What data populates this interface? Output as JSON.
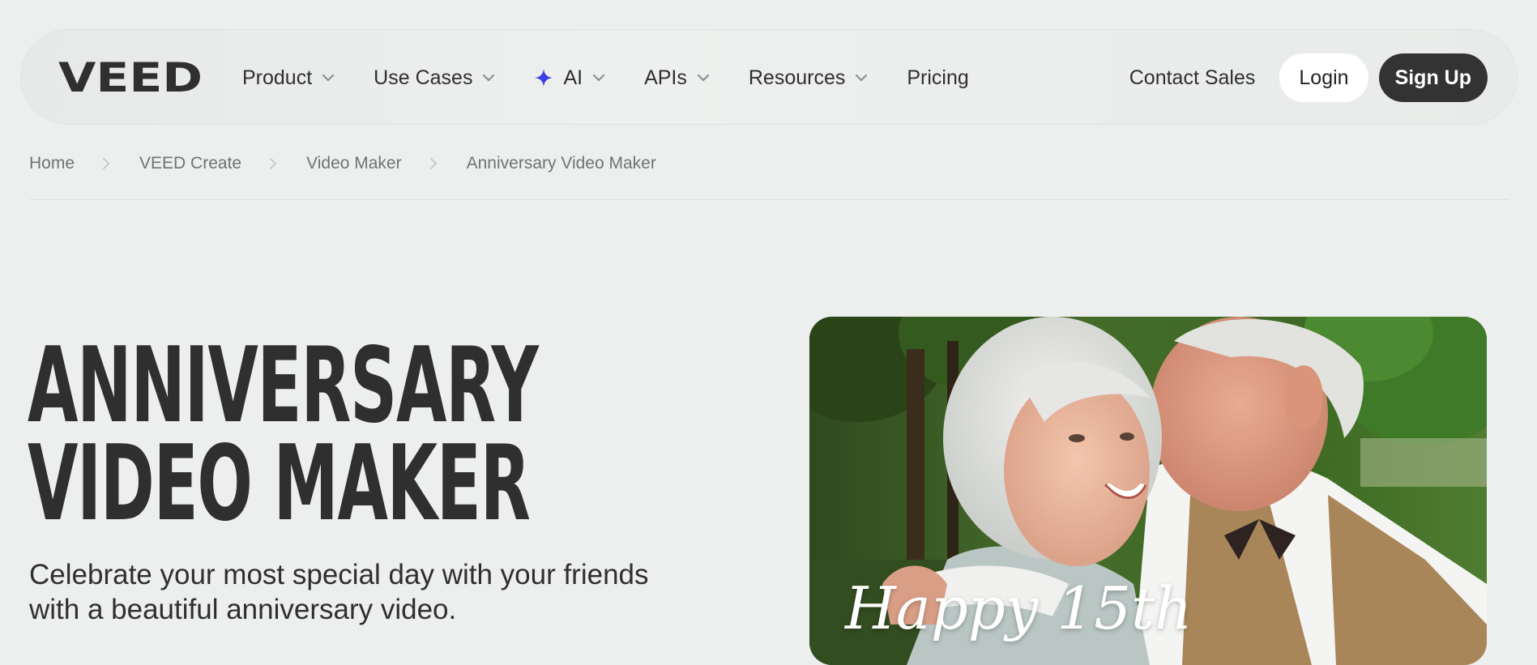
{
  "brand": {
    "logo_text": "VEED",
    "colors": {
      "text": "#2f2f2f",
      "accent": "#3b3fe8",
      "signup_bg": "#333333"
    }
  },
  "nav": {
    "items": [
      {
        "label": "Product",
        "icon": "chevron-down-icon"
      },
      {
        "label": "Use Cases",
        "icon": "chevron-down-icon"
      },
      {
        "label": "AI",
        "icon": "chevron-down-icon",
        "prefix_icon": "sparkle-icon"
      },
      {
        "label": "APIs",
        "icon": "chevron-down-icon"
      },
      {
        "label": "Resources",
        "icon": "chevron-down-icon"
      },
      {
        "label": "Pricing"
      }
    ],
    "contact_label": "Contact Sales",
    "login_label": "Login",
    "signup_label": "Sign Up"
  },
  "breadcrumb": {
    "items": [
      "Home",
      "VEED Create",
      "Video Maker",
      "Anniversary Video Maker"
    ],
    "separator_icon": "chevron-right-icon"
  },
  "hero": {
    "title_line1": "ANNIVERSARY",
    "title_line2": "VIDEO MAKER",
    "subtitle": "Celebrate your most special day with your friends with a beautiful anniversary video.",
    "image": {
      "description_icon": "couple-photo",
      "overlay_text": "Happy 15th"
    }
  }
}
